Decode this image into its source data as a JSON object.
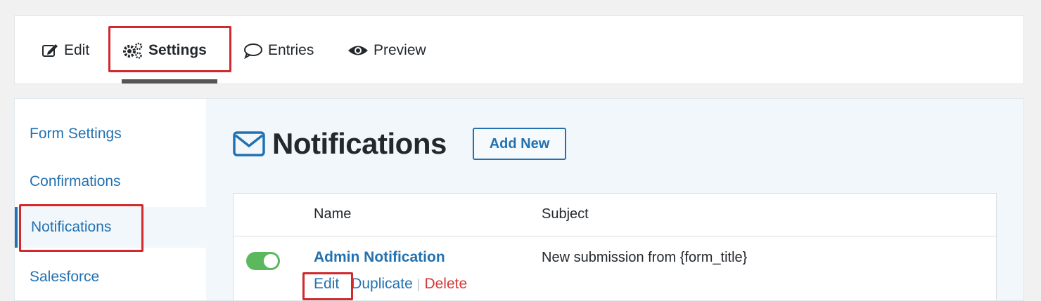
{
  "toolbar": {
    "tabs": [
      {
        "label": "Edit",
        "icon": "edit-icon"
      },
      {
        "label": "Settings",
        "icon": "gears-icon"
      },
      {
        "label": "Entries",
        "icon": "comment-icon"
      },
      {
        "label": "Preview",
        "icon": "eye-icon"
      }
    ],
    "active_tab": "Settings"
  },
  "sidebar": {
    "items": [
      {
        "label": "Form Settings"
      },
      {
        "label": "Confirmations"
      },
      {
        "label": "Notifications"
      },
      {
        "label": "Salesforce"
      }
    ],
    "active_item": "Notifications"
  },
  "main": {
    "title": "Notifications",
    "title_icon": "envelope-icon",
    "add_new_label": "Add New",
    "table": {
      "columns": [
        "Name",
        "Subject"
      ],
      "rows": [
        {
          "enabled": true,
          "name": "Admin Notification",
          "subject": "New submission from {form_title}",
          "actions": {
            "edit": "Edit",
            "duplicate": "Duplicate",
            "delete": "Delete"
          }
        }
      ]
    }
  },
  "colors": {
    "accent": "#2271b1",
    "highlight": "#d0292e",
    "toggle_on": "#5cb85c",
    "delete": "#d63638"
  }
}
